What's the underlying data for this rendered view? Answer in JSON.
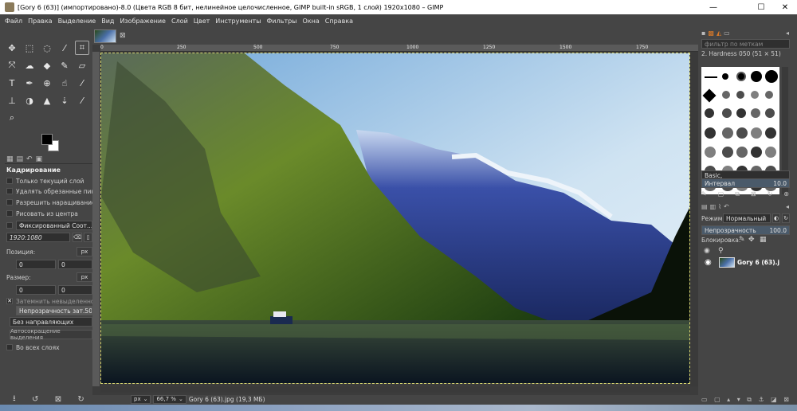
{
  "window": {
    "title": "[Gory 6 (63)] (импортировано)-8.0 (Цвета RGB 8 бит, нелинейное целочисленное, GIMP built-in sRGB, 1 слой) 1920x1080 – GIMP",
    "minimize": "—",
    "maximize": "☐",
    "close": "✕"
  },
  "menu": [
    "Файл",
    "Правка",
    "Выделение",
    "Вид",
    "Изображение",
    "Слой",
    "Цвет",
    "Инструменты",
    "Фильтры",
    "Окна",
    "Справка"
  ],
  "tool_options": {
    "title": "Кадрирование",
    "current_layer_only": "Только текущий слой",
    "delete_cropped": "Удалять обрезанные пиксе",
    "allow_growing": "Разрешить наращивание",
    "from_center": "Рисовать из центра",
    "fixed_label": "Фиксированный Соот...",
    "ratio_value": "1920:1080",
    "position_label": "Позиция:",
    "position_unit": "px",
    "pos_x": "0",
    "pos_y": "0",
    "size_label": "Размер:",
    "size_unit": "px",
    "size_w": "0",
    "size_h": "0",
    "highlight": "Затемнить невыделенное",
    "opacity_label": "Непрозрачность зат.",
    "opacity_value": "50.0",
    "guides": "Без направляющих",
    "auto_shrink": "Автосокращение выделения",
    "all_layers": "Во всех слоях"
  },
  "ruler": {
    "ticks": [
      "0",
      "250",
      "500",
      "750",
      "1000",
      "1250",
      "1500",
      "1750"
    ]
  },
  "statusbar": {
    "unit": "px",
    "zoom": "66,7 %",
    "filename": "Gory 6 (63).jpg (19,3 МБ)"
  },
  "brushes": {
    "filter_placeholder": "фильтр по меткам",
    "current": "2. Hardness 050 (51 × 51)",
    "preset": "Basic,",
    "spacing_label": "Интервал",
    "spacing_value": "10.0"
  },
  "layers": {
    "mode_label": "Режим",
    "mode_value": "Нормальный",
    "opacity_label": "Непрозрачность",
    "opacity_value": "100.0",
    "lock_label": "Блокировка:",
    "layer_name": "Gory 6 (63).j"
  }
}
